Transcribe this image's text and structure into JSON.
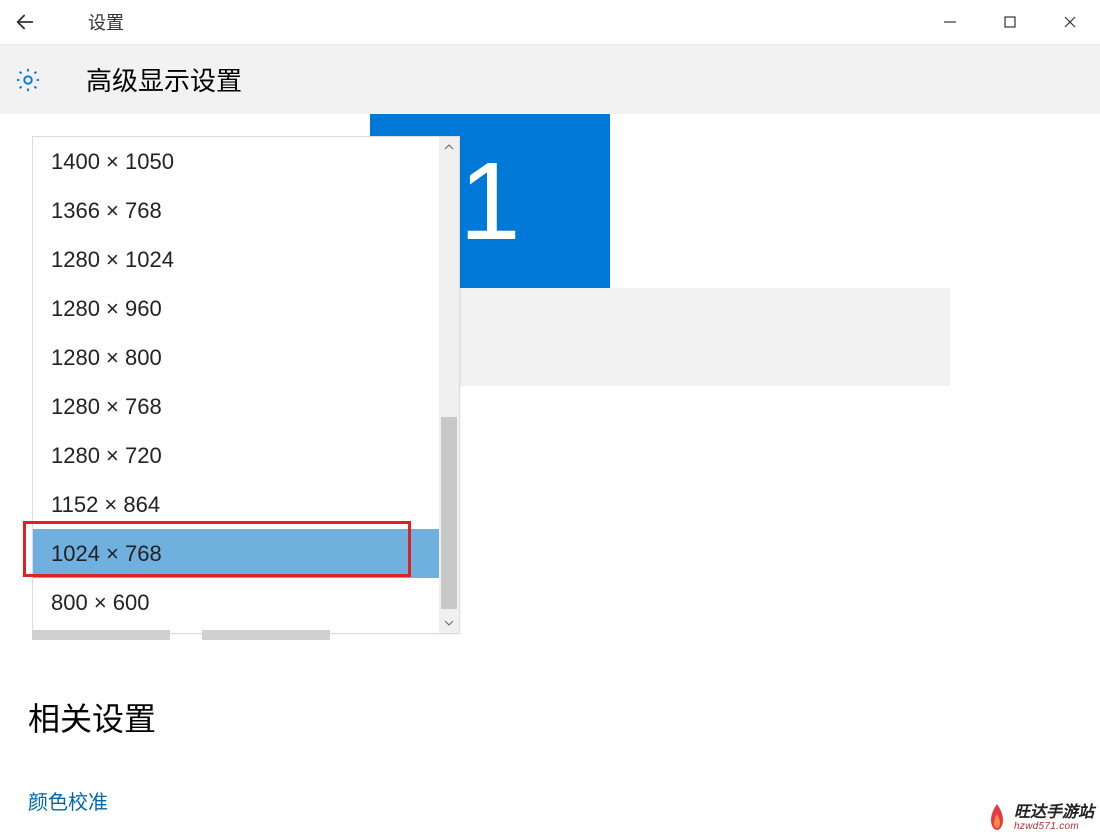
{
  "titlebar": {
    "app_title": "设置"
  },
  "header": {
    "page_title": "高级显示设置"
  },
  "monitor": {
    "number": "1"
  },
  "resolution_dropdown": {
    "items": [
      "1400 × 1050",
      "1366 × 768",
      "1280 × 1024",
      "1280 × 960",
      "1280 × 800",
      "1280 × 768",
      "1280 × 720",
      "1152 × 864",
      "1024 × 768",
      "800 × 600"
    ],
    "selected_index": 8
  },
  "related": {
    "heading": "相关设置",
    "color_calibration": "颜色校准"
  },
  "watermark": {
    "name": "旺达手游站",
    "url": "hzwd571.com"
  }
}
